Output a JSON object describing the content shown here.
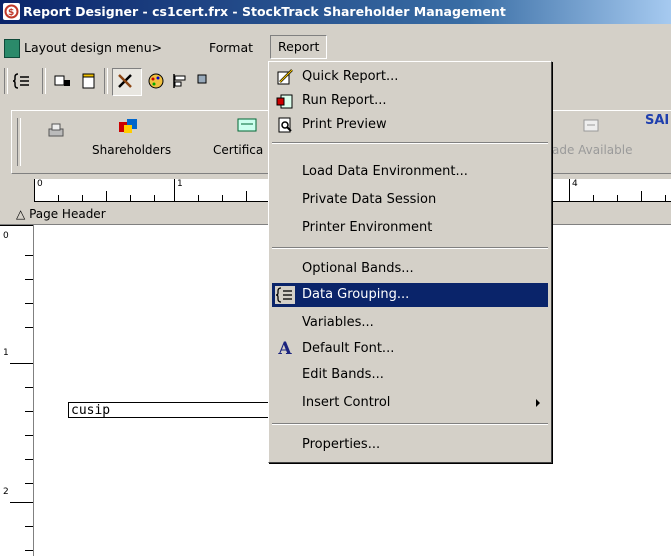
{
  "window": {
    "title": "Report Designer - cs1cert.frx - StockTrack Shareholder Management"
  },
  "menubar": {
    "layout_menu": "Layout design menu>",
    "format": "Format",
    "report": "Report"
  },
  "toolbar2": {
    "shareholders": "Shareholders",
    "certificates": "Certifica",
    "trades_available": "ade Available",
    "sa_label": "SAI"
  },
  "ruler": {
    "marks": [
      "0",
      "1",
      "4"
    ]
  },
  "vruler": {
    "marks": [
      "0",
      "1",
      "2"
    ]
  },
  "band": {
    "page_header": "Page Header"
  },
  "canvas": {
    "field_cusip": "cusip"
  },
  "report_menu": {
    "items": [
      {
        "label": "Quick Report...",
        "icon": "quick-report-icon"
      },
      {
        "label": "Run Report...",
        "icon": "run-report-icon"
      },
      {
        "label": "Print Preview",
        "icon": "print-preview-icon"
      },
      {
        "label": "Load Data Environment..."
      },
      {
        "label": "Private Data Session"
      },
      {
        "label": "Printer Environment"
      },
      {
        "label": "Optional Bands..."
      },
      {
        "label": "Data Grouping...",
        "icon": "data-grouping-icon",
        "highlighted": true
      },
      {
        "label": "Variables..."
      },
      {
        "label": "Default Font...",
        "icon": "font-icon"
      },
      {
        "label": "Edit Bands..."
      },
      {
        "label": "Insert Control",
        "has_submenu": true
      },
      {
        "label": "Properties..."
      }
    ]
  },
  "colors": {
    "highlight": "#0a246a",
    "titlebar": "#0a246a",
    "face": "#d4d0c8"
  }
}
